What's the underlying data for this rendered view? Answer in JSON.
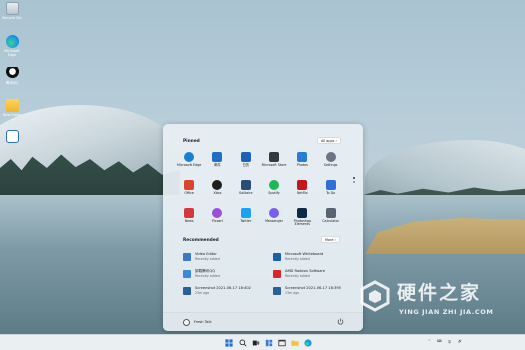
{
  "desktop": {
    "icons": [
      {
        "label": "Recycle Bin",
        "icon": "recycle-bin-icon"
      },
      {
        "label": "Microsoft Edge",
        "icon": "edge-icon"
      },
      {
        "label": "腾讯QQ",
        "icon": "qq-icon"
      },
      {
        "label": "New folder",
        "icon": "folder-icon"
      },
      {
        "label": "",
        "icon": "app-shortcut-icon"
      }
    ]
  },
  "start_menu": {
    "pinned_title": "Pinned",
    "all_apps_label": "All apps",
    "pinned_apps": [
      {
        "label": "Microsoft Edge",
        "icon": "edge-icon",
        "color": "#1b7fd0"
      },
      {
        "label": "邮件",
        "icon": "mail-icon",
        "color": "#1f6fc5"
      },
      {
        "label": "日历",
        "icon": "calendar-icon",
        "color": "#1a63b8"
      },
      {
        "label": "Microsoft Store",
        "icon": "store-icon",
        "color": "#333a44"
      },
      {
        "label": "Photos",
        "icon": "photos-icon",
        "color": "#2a7bd6"
      },
      {
        "label": "Settings",
        "icon": "settings-icon",
        "color": "#6b7480"
      },
      {
        "label": "Office",
        "icon": "office-icon",
        "color": "#d9452a"
      },
      {
        "label": "Xbox",
        "icon": "xbox-icon",
        "color": "#1e1e1e"
      },
      {
        "label": "Solitaire",
        "icon": "solitaire-icon",
        "color": "#2a4c7a"
      },
      {
        "label": "Spotify",
        "icon": "spotify-icon",
        "color": "#1db954"
      },
      {
        "label": "Netflix",
        "icon": "netflix-icon",
        "color": "#c4161c"
      },
      {
        "label": "To Do",
        "icon": "todo-icon",
        "color": "#2f6fdb"
      },
      {
        "label": "News",
        "icon": "news-icon",
        "color": "#d23a3a"
      },
      {
        "label": "Picsart",
        "icon": "picsart-icon",
        "color": "#9b4fd6"
      },
      {
        "label": "Twitter",
        "icon": "twitter-icon",
        "color": "#1da1f2"
      },
      {
        "label": "Messenger",
        "icon": "messenger-icon",
        "color": "#7a5cf0"
      },
      {
        "label": "Photoshop Elements",
        "icon": "photoshop-icon",
        "color": "#0f2a47"
      },
      {
        "label": "Calculator",
        "icon": "calculator-icon",
        "color": "#5a6470"
      }
    ],
    "recommended_title": "Recommended",
    "more_label": "More",
    "recommended": [
      {
        "title": "Video Editor",
        "subtitle": "Recently added",
        "icon": "video-editor-icon",
        "color": "#3a78c8"
      },
      {
        "title": "Microsoft Whiteboard",
        "subtitle": "Recently added",
        "icon": "whiteboard-icon",
        "color": "#1b5fa8"
      },
      {
        "title": "卸载腾讯QQ",
        "subtitle": "Recently added",
        "icon": "qq-uninstall-icon",
        "color": "#3a8ad8"
      },
      {
        "title": "AMD Radeon Software",
        "subtitle": "Recently added",
        "icon": "amd-icon",
        "color": "#d8262b"
      },
      {
        "title": "Screenshot 2021-06-17 18:402",
        "subtitle": "23m ago",
        "icon": "screenshot-file-icon",
        "color": "#2d5f9a"
      },
      {
        "title": "Screenshot 2021-06-17 18:395",
        "subtitle": "23m ago",
        "icon": "screenshot-file-icon",
        "color": "#2d5f9a"
      }
    ],
    "user_name": "Fresh Talk"
  },
  "taskbar": {
    "icons": [
      "start-icon",
      "search-icon",
      "task-view-icon",
      "widgets-icon",
      "file-explorer-icon",
      "folder-icon",
      "edge-icon"
    ],
    "tray": [
      "^",
      "⌨",
      "中",
      "🔊"
    ]
  },
  "watermark": {
    "title": "硬件之家",
    "subtitle": "YING JIAN ZHI JIA.COM"
  }
}
